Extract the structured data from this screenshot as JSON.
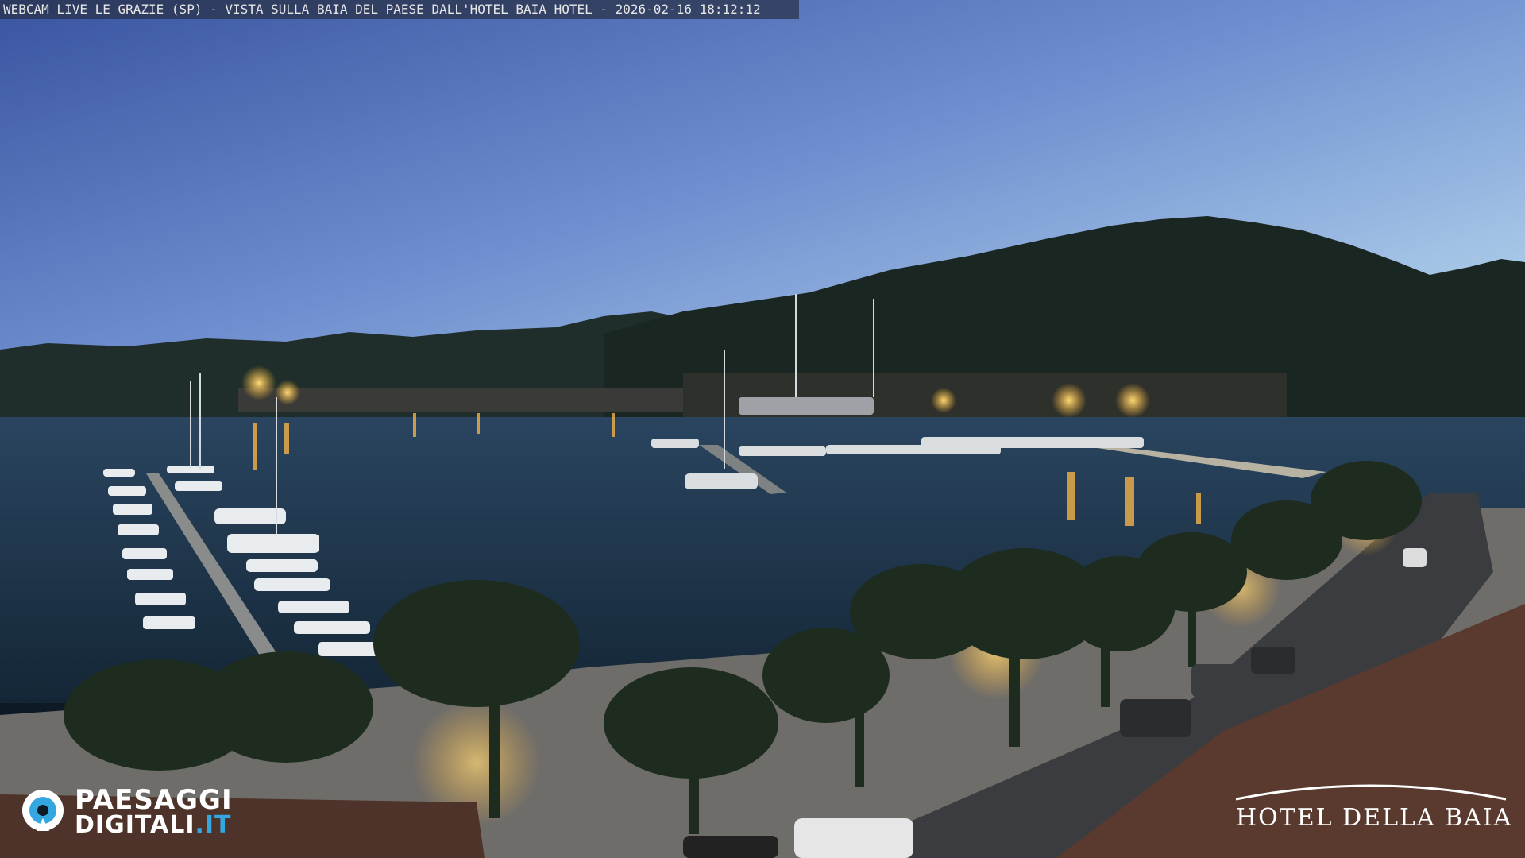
{
  "overlay": {
    "caption": "WEBCAM LIVE LE GRAZIE (SP) - VISTA SULLA BAIA DEL PAESE DALL'HOTEL BAIA HOTEL - 2026-02-16 18:12:12"
  },
  "logo_left": {
    "line1": "PAESAGGI",
    "line2_main": "DIGITALI",
    "line2_accent": ".IT",
    "icon": "eye-icon"
  },
  "logo_right": {
    "text": "HOTEL DELLA BAIA"
  },
  "colors": {
    "sky_top": "#3d5aa5",
    "sky_bottom": "#9ec4e0",
    "water": "#1c3349",
    "hills": "#1d2a25",
    "lights": "#ffc44d",
    "accent": "#35a7e0"
  }
}
